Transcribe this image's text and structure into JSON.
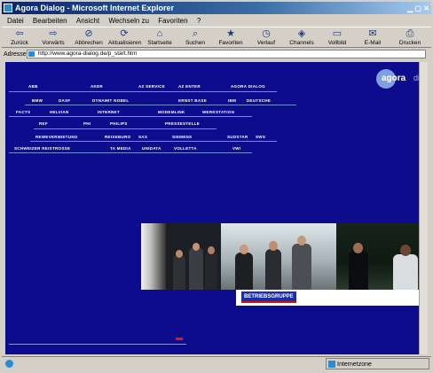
{
  "window": {
    "title": "Agora Dialog - Microsoft Internet Explorer",
    "controls": "▁ ▢ ✕"
  },
  "menu": [
    "Datei",
    "Bearbeiten",
    "Ansicht",
    "Wechseln zu",
    "Favoriten",
    "?"
  ],
  "toolbar": [
    {
      "icon": "⇦",
      "label": "Zurück"
    },
    {
      "icon": "⇨",
      "label": "Vorwärts"
    },
    {
      "icon": "⊘",
      "label": "Abbrechen"
    },
    {
      "icon": "⟳",
      "label": "Aktualisieren"
    },
    {
      "icon": "⌂",
      "label": "Startseite"
    },
    {
      "icon": "⌕",
      "label": "Suchen"
    },
    {
      "icon": "★",
      "label": "Favoriten"
    },
    {
      "icon": "◷",
      "label": "Verlauf"
    },
    {
      "icon": "◈",
      "label": "Channels"
    },
    {
      "icon": "▭",
      "label": "Vollbild"
    },
    {
      "icon": "✉",
      "label": "E-Mail"
    },
    {
      "icon": "⎙",
      "label": "Drucken"
    }
  ],
  "address": {
    "label": "Adresse",
    "url": "http://www.agora-dialog.de/p_start.htm"
  },
  "logo": {
    "primary": "agora",
    "secondary": "dialog"
  },
  "nav_rows": [
    [
      "ABB",
      "AKER",
      "AZ SERVICE",
      "AZ ENTER",
      "AGORA DIALOG"
    ],
    [
      "BMW",
      "DASF",
      "DYNAMIT NOBEL",
      "ERNST BASE",
      "IBM",
      "DEUTSCHE"
    ],
    [
      "FACTS",
      "HELVIAN",
      "INTERNET",
      "MODEMLINK",
      "WERKSTATION"
    ],
    [
      "REF",
      "PHI",
      "PHILIPS",
      "PRESSESTELLE"
    ],
    [
      "REWEVERMIETUNG",
      "REISEBURO",
      "SAS",
      "SIEMENS",
      "SUDSTAR",
      "SWS"
    ],
    [
      "SCHWEIZER REISTROSSE",
      "TA MEDIA",
      "UNIDATA",
      "VOLLETTA",
      "VWI"
    ]
  ],
  "banner": {
    "badge": "BETRIEBSGRUPPE"
  },
  "status": {
    "left": "",
    "zone": "Internetzone"
  },
  "colors": {
    "page_bg": "#0c0c8c",
    "link_underline": "#6f8fd0",
    "accent_red": "#d81e1e"
  }
}
